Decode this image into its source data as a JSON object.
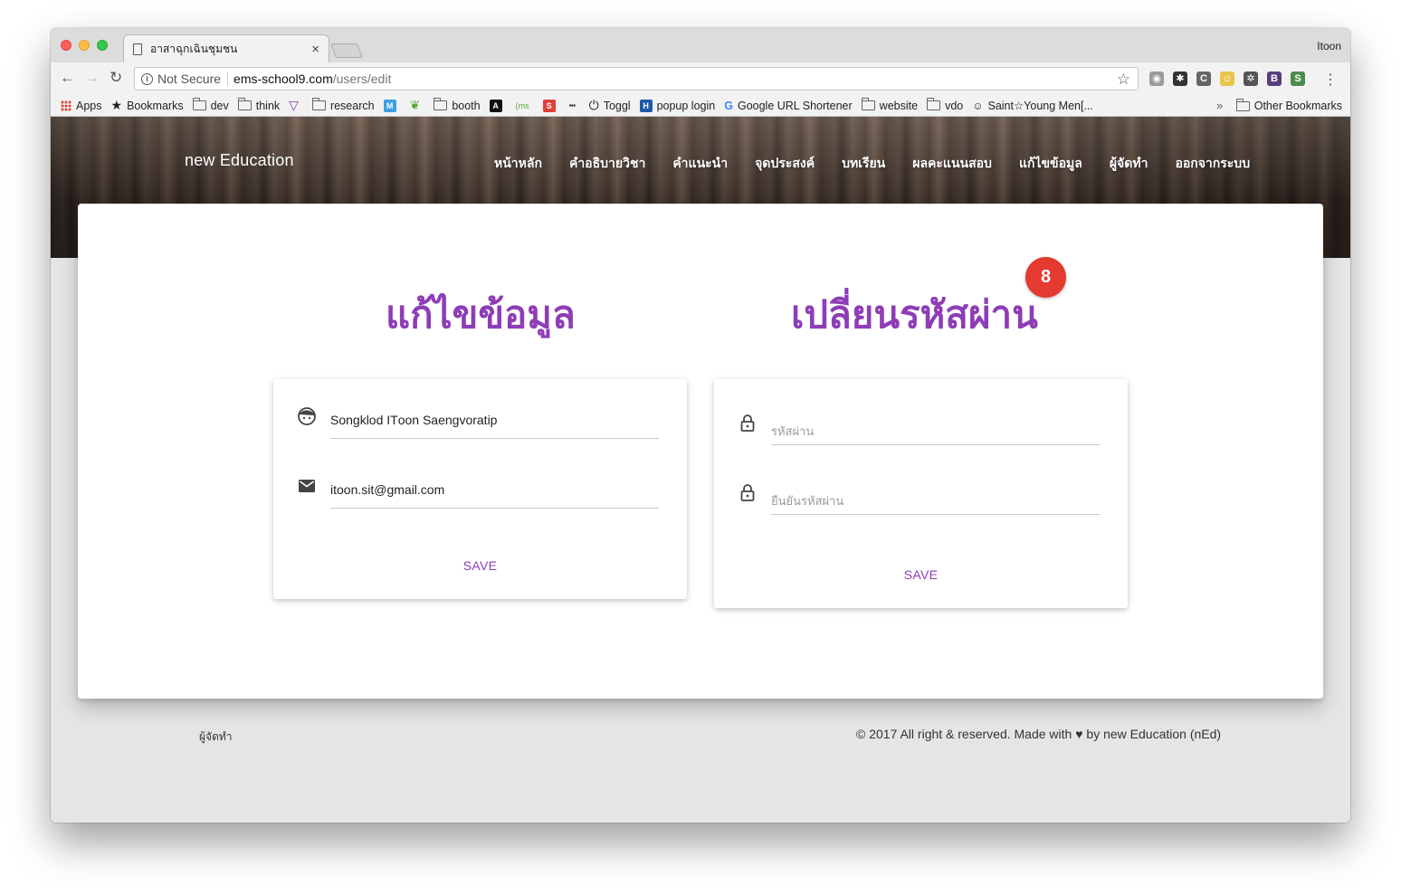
{
  "browser": {
    "tab_title": "อาสาฉุกเฉินชุมชน",
    "profile_name": "Itoon",
    "security_label": "Not Secure",
    "url_host": "ems-school9.com",
    "url_path": "/users/edit",
    "bookmarks": [
      {
        "label": "Apps",
        "icon": "apps-grid-icon"
      },
      {
        "label": "Bookmarks",
        "icon": "star-icon"
      },
      {
        "label": "dev",
        "icon": "folder-icon"
      },
      {
        "label": "think",
        "icon": "folder-icon"
      },
      {
        "label": "",
        "icon": "vuetify-icon"
      },
      {
        "label": "research",
        "icon": "folder-icon"
      },
      {
        "label": "",
        "icon": "m-icon"
      },
      {
        "label": "",
        "icon": "leaf-icon"
      },
      {
        "label": "booth",
        "icon": "folder-icon"
      },
      {
        "label": "",
        "icon": "a-icon"
      },
      {
        "label": "",
        "icon": "ms-icon"
      },
      {
        "label": "",
        "icon": "s-icon"
      },
      {
        "label": "",
        "icon": "bbc-icon"
      },
      {
        "label": "Toggl",
        "icon": "toggl-icon"
      },
      {
        "label": "popup login",
        "icon": "h-icon"
      },
      {
        "label": "Google URL Shortener",
        "icon": "google-icon"
      },
      {
        "label": "website",
        "icon": "folder-icon"
      },
      {
        "label": "vdo",
        "icon": "folder-icon"
      },
      {
        "label": "Saint☆Young Men[...",
        "icon": "character-icon"
      }
    ],
    "other_bookmarks": "Other Bookmarks"
  },
  "site": {
    "brand": "new Education",
    "nav": [
      "หน้าหลัก",
      "คำอธิบายวิชา",
      "คำแนะนำ",
      "จุดประสงค์",
      "บทเรียน",
      "ผลคะแนนสอบ",
      "แก้ไขข้อมูล",
      "ผู้จัดทำ",
      "ออกจากระบบ"
    ],
    "badge": "8"
  },
  "edit_profile": {
    "title": "แก้ไขข้อมูล",
    "name_value": "Songklod ITоon Saengvoratip",
    "email_value": "itoon.sit@gmail.com",
    "save_label": "SAVE"
  },
  "change_password": {
    "title": "เปลี่ยนรหัสผ่าน",
    "password_placeholder": "รหัสผ่าน",
    "confirm_placeholder": "ยืนยันรหัสผ่าน",
    "save_label": "SAVE"
  },
  "footer": {
    "credit_link": "ผู้จัดทำ",
    "copyright_prefix": "© 2017 All right & reserved. Made with",
    "copyright_suffix": "by new Education (nEd)"
  },
  "colors": {
    "accent": "#8e3db6",
    "badge": "#e53a30"
  }
}
